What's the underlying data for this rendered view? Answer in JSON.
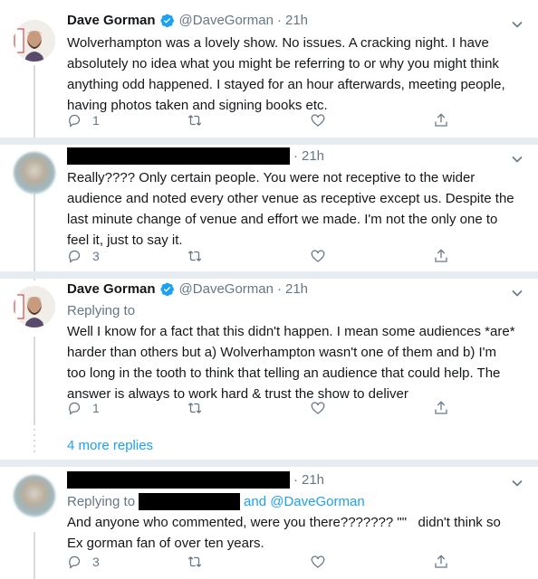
{
  "tweets": [
    {
      "name": "Dave Gorman",
      "handle": "@DaveGorman",
      "time": "21h",
      "lines": [
        "Wolverhampton was a lovely show. No issues. A cracking night. I have",
        "absolutely no idea what you might be referring to or why you might think",
        "anything odd happened. I stayed for an hour afterwards, meeting people,",
        "having photos taken and signing books etc."
      ],
      "reply_count": "1"
    },
    {
      "time": "21h",
      "lines": [
        "Really???? Only certain people. You were not receptive to the wider",
        "audience and noted every other venue as receptive except us. Despite the",
        "last minute change of venue and effort we made. I'm not the only one to",
        "feel it, just to say it."
      ],
      "reply_count": "3"
    },
    {
      "name": "Dave Gorman",
      "handle": "@DaveGorman",
      "time": "21h",
      "replying_label": "Replying to",
      "lines": [
        "Well I know for a fact that this didn't happen. I mean some audiences *are*",
        "harder than others but a) Wolverhampton wasn't one of them and b) I'm",
        "too long in the tooth to think that telling an audience that could help. The",
        "answer is always to work hard & trust the show to deliver"
      ],
      "reply_count": "1"
    },
    {
      "time": "21h",
      "replying_label": "Replying to",
      "replying_extra": "and @DaveGorman",
      "lines": [
        "And anyone who commented, were you there??????? \"\"   didn't think so",
        "Ex gorman fan of over ten years."
      ],
      "reply_count": "3"
    }
  ],
  "more_replies": "4 more replies",
  "icons": {
    "reply": "reply-icon",
    "retweet": "retweet-icon",
    "like": "heart-icon",
    "share": "share-icon",
    "menu": "chevron-down-icon",
    "verified": "verified-badge-icon"
  },
  "colors": {
    "link": "#1da1f2",
    "muted": "#657786",
    "text": "#14171a",
    "divider": "#e6ecf0"
  }
}
